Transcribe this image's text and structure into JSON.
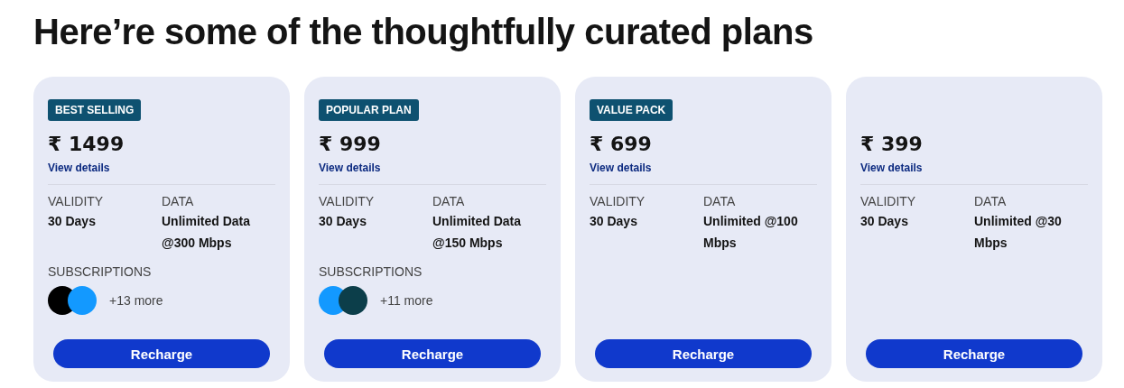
{
  "heading": "Here’re some of the thoughtfully curated plans",
  "plans": [
    {
      "badge": "BEST SELLING",
      "price": "₹ 1499",
      "details_link": "View details",
      "validity_label": "VALIDITY",
      "validity": "30 Days",
      "data_label": "DATA",
      "data": "Unlimited Data @300 Mbps",
      "subscriptions_label": "SUBSCRIPTIONS",
      "subscriptions": [
        {
          "color": "#000000"
        },
        {
          "color": "#1399ff"
        }
      ],
      "more": "+13 more",
      "button": "Recharge"
    },
    {
      "badge": "POPULAR PLAN",
      "price": "₹ 999",
      "details_link": "View details",
      "validity_label": "VALIDITY",
      "validity": "30 Days",
      "data_label": "DATA",
      "data": "Unlimited Data @150 Mbps",
      "subscriptions_label": "SUBSCRIPTIONS",
      "subscriptions": [
        {
          "color": "#1399ff"
        },
        {
          "color": "#0c3e4a"
        }
      ],
      "more": "+11 more",
      "button": "Recharge"
    },
    {
      "badge": "VALUE PACK",
      "price": "₹ 699",
      "details_link": "View details",
      "validity_label": "VALIDITY",
      "validity": "30 Days",
      "data_label": "DATA",
      "data": "Unlimited @100 Mbps",
      "button": "Recharge"
    },
    {
      "price": "₹ 399",
      "details_link": "View details",
      "validity_label": "VALIDITY",
      "validity": "30 Days",
      "data_label": "DATA",
      "data": "Unlimited @30 Mbps",
      "button": "Recharge"
    }
  ]
}
